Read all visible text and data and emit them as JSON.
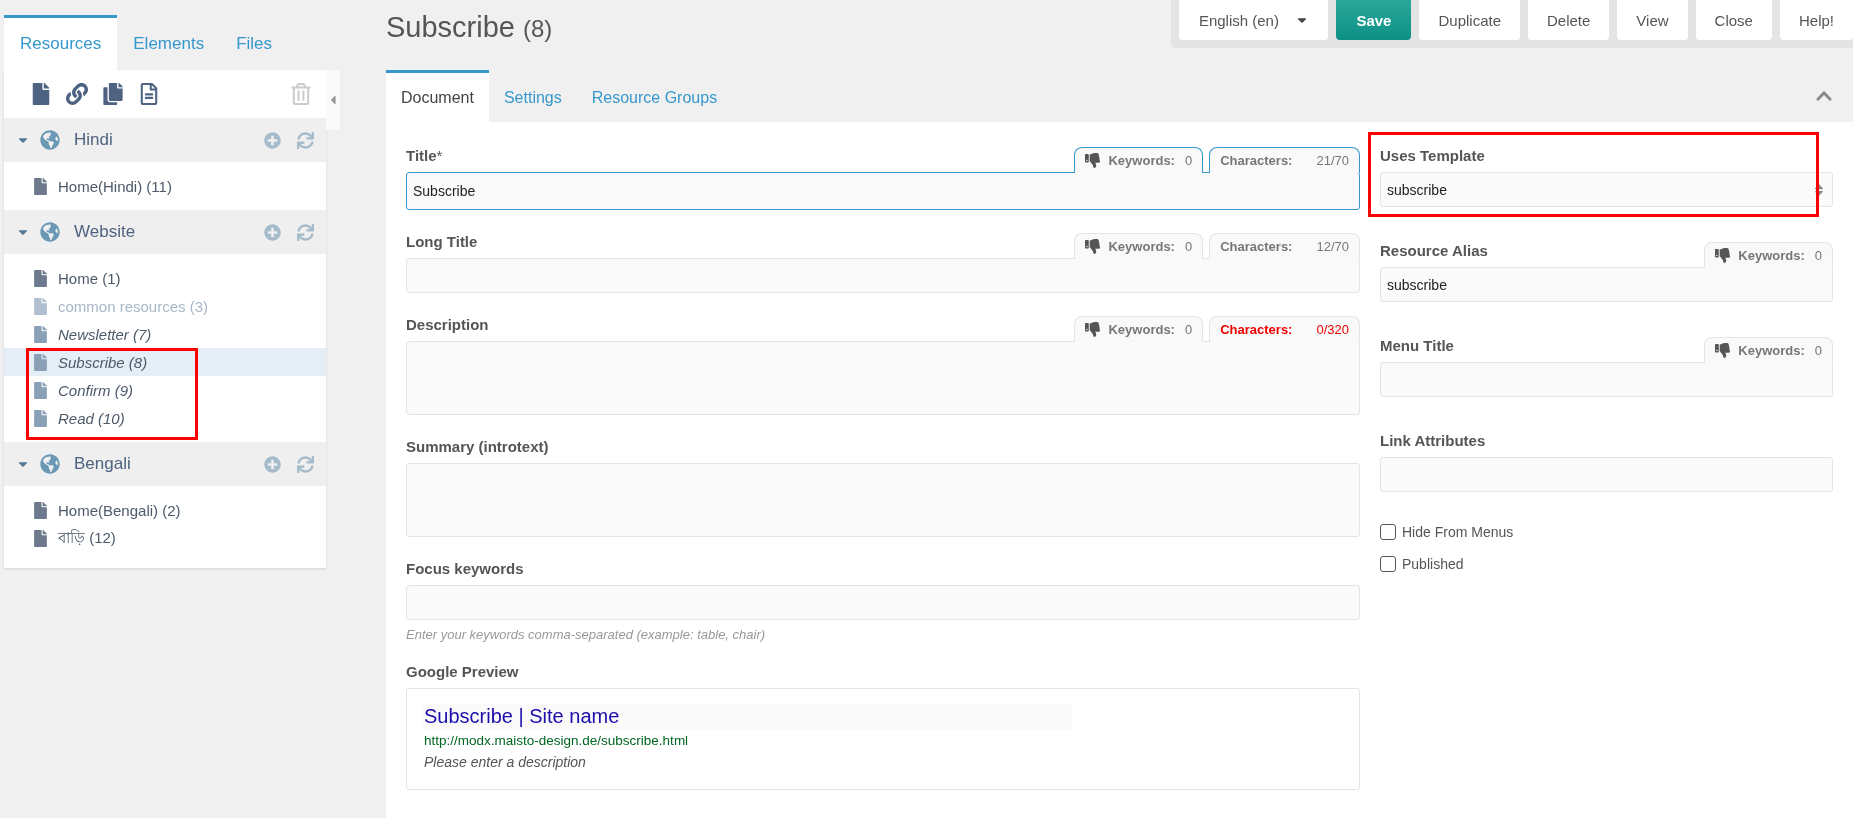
{
  "sidebar": {
    "tabs": [
      {
        "label": "Resources",
        "selected": true
      },
      {
        "label": "Elements",
        "selected": false
      },
      {
        "label": "Files",
        "selected": false
      }
    ],
    "tree": [
      {
        "label": "Hindi",
        "expanded": true,
        "children": [
          {
            "label": "Home(Hindi) (11)",
            "selected": false,
            "unpublished": false,
            "hidden": false,
            "deleted": false,
            "highlighted": false
          }
        ]
      },
      {
        "label": "Website",
        "expanded": true,
        "children": [
          {
            "label": "Home (1)",
            "selected": false,
            "unpublished": false,
            "hidden": false,
            "deleted": false,
            "highlighted": false
          },
          {
            "label": "common resources (3)",
            "selected": false,
            "unpublished": false,
            "hidden": true,
            "deleted": false,
            "highlighted": false
          },
          {
            "label": "Newsletter (7)",
            "selected": false,
            "unpublished": true,
            "hidden": false,
            "deleted": false,
            "highlighted": false
          },
          {
            "label": "Subscribe (8)",
            "selected": true,
            "unpublished": true,
            "hidden": false,
            "deleted": false,
            "highlighted": true
          },
          {
            "label": "Confirm (9)",
            "selected": false,
            "unpublished": true,
            "hidden": false,
            "deleted": false,
            "highlighted": true
          },
          {
            "label": "Read (10)",
            "selected": false,
            "unpublished": true,
            "hidden": false,
            "deleted": false,
            "highlighted": true
          }
        ]
      },
      {
        "label": "Bengali",
        "expanded": true,
        "children": [
          {
            "label": "Home(Bengali) (2)",
            "selected": false,
            "unpublished": false,
            "hidden": false,
            "deleted": false,
            "highlighted": false
          },
          {
            "label": "বাড়ি (12)",
            "selected": false,
            "unpublished": false,
            "hidden": false,
            "deleted": false,
            "highlighted": false
          }
        ]
      }
    ]
  },
  "page": {
    "title": "Subscribe",
    "count": "(8)"
  },
  "toolbar": {
    "language": "English (en)",
    "buttons": [
      {
        "label": "Save",
        "kind": "primary"
      },
      {
        "label": "Duplicate",
        "kind": "default"
      },
      {
        "label": "Delete",
        "kind": "default"
      },
      {
        "label": "View",
        "kind": "default"
      },
      {
        "label": "Close",
        "kind": "default"
      },
      {
        "label": "Help!",
        "kind": "default"
      }
    ]
  },
  "tabs": [
    {
      "label": "Document",
      "selected": true
    },
    {
      "label": "Settings",
      "selected": false
    },
    {
      "label": "Resource Groups",
      "selected": false
    }
  ],
  "fields": [
    {
      "label": "Title",
      "required_mark": "*",
      "kind": "input",
      "value": "Subscribe",
      "focused": true,
      "keywords": {
        "label": "Keywords:",
        "value": "0"
      },
      "characters": {
        "label": "Characters:",
        "value": "21/70",
        "warning": false
      }
    },
    {
      "label": "Long Title",
      "kind": "input",
      "focused": false,
      "keywords": {
        "label": "Keywords:",
        "value": "0"
      },
      "characters": {
        "label": "Characters:",
        "value": "12/70",
        "warning": false
      }
    },
    {
      "label": "Description",
      "kind": "textarea",
      "keywords": {
        "label": "Keywords:",
        "value": "0"
      },
      "characters": {
        "label": "Characters:",
        "value": "0/320",
        "warning": true
      }
    },
    {
      "label": "Summary (introtext)",
      "kind": "textarea"
    },
    {
      "label": "Focus keywords",
      "kind": "input",
      "focused": false,
      "hint": "Enter your keywords comma-separated (example: table, chair)"
    }
  ],
  "google_preview": {
    "label": "Google Preview",
    "title": "Subscribe | Site name",
    "url": "http://modx.maisto-design.de/subscribe.html",
    "description": "Please enter a description"
  },
  "side_fields": [
    {
      "label": "Uses Template",
      "kind": "select",
      "value": "subscribe",
      "highlighted": true
    },
    {
      "label": "Resource Alias",
      "kind": "input",
      "value": "subscribe",
      "highlighted": false,
      "keywords": {
        "label": "Keywords:",
        "value": "0"
      }
    },
    {
      "label": "Menu Title",
      "kind": "input",
      "highlighted": false,
      "keywords": {
        "label": "Keywords:",
        "value": "0"
      }
    },
    {
      "label": "Link Attributes",
      "kind": "input",
      "highlighted": false
    }
  ],
  "checkboxes": [
    {
      "label": "Hide From Menus",
      "checked": false
    },
    {
      "label": "Published",
      "checked": false
    }
  ]
}
